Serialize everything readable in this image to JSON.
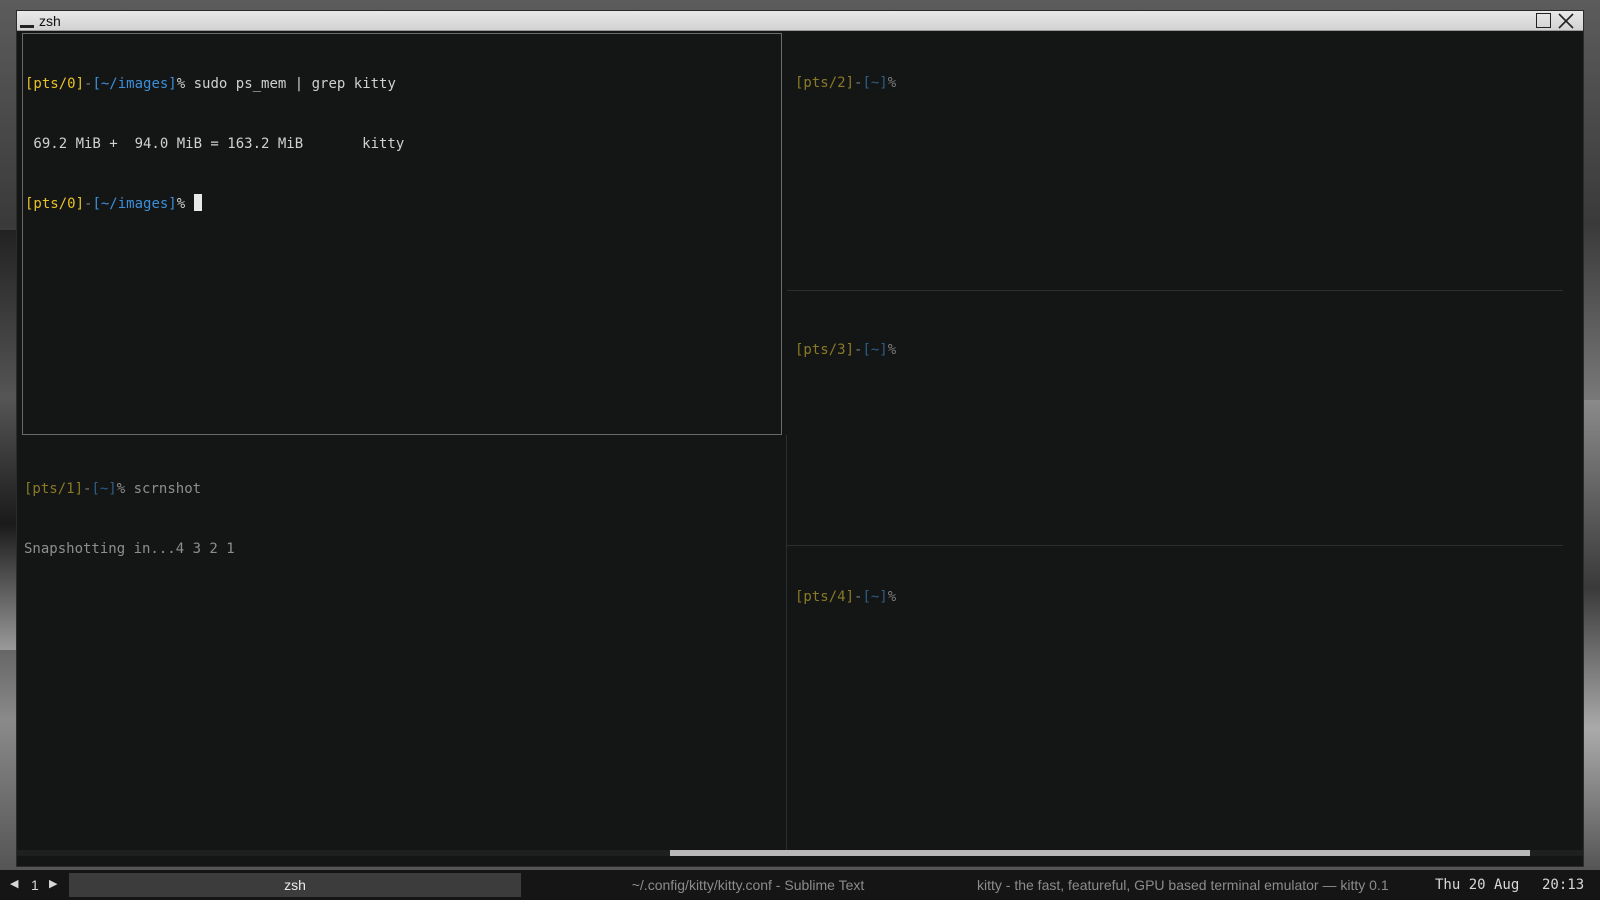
{
  "window": {
    "title": "zsh"
  },
  "panes": {
    "p0": {
      "line1_prompt_tty": "[pts/0]",
      "line1_prompt_sep": "-",
      "line1_prompt_dir": "[~/images]",
      "line1_prompt_char": "%",
      "line1_command": " sudo ps_mem | grep kitty",
      "line2_output": " 69.2 MiB +  94.0 MiB = 163.2 MiB       kitty",
      "line3_prompt_tty": "[pts/0]",
      "line3_prompt_sep": "-",
      "line3_prompt_dir": "[~/images]",
      "line3_prompt_char": "% "
    },
    "p1": {
      "prompt_tty": "[pts/1]",
      "prompt_sep": "-",
      "prompt_dir": "[~]",
      "prompt_char": "%",
      "command": " scrnshot",
      "output": "Snapshotting in...4 3 2 1"
    },
    "p2": {
      "prompt_tty": "[pts/2]",
      "prompt_sep": "-",
      "prompt_dir": "[~]",
      "prompt_char": "%"
    },
    "p3": {
      "prompt_tty": "[pts/3]",
      "prompt_sep": "-",
      "prompt_dir": "[~]",
      "prompt_char": "%"
    },
    "p4": {
      "prompt_tty": "[pts/4]",
      "prompt_sep": "-",
      "prompt_dir": "[~]",
      "prompt_char": "%"
    }
  },
  "taskbar": {
    "prev_icon": "◀",
    "desktop_number": "1",
    "next_icon": "▶",
    "tasks": [
      "zsh",
      "~/.config/kitty/kitty.conf - Sublime Text",
      "kitty - the fast, featureful, GPU based terminal emulator — kitty 0.1"
    ],
    "date": "Thu 20 Aug",
    "time": "20:13"
  },
  "colors": {
    "terminal_bg": "#141616",
    "prompt_tty": "#e8c229",
    "prompt_dir": "#3b8fd9",
    "inactive_prompt_tty": "#8a7a26",
    "inactive_prompt_dir": "#2e5d88"
  },
  "icons": {
    "minimize": "minimize-icon",
    "maximize": "maximize-icon",
    "close": "close-icon"
  }
}
